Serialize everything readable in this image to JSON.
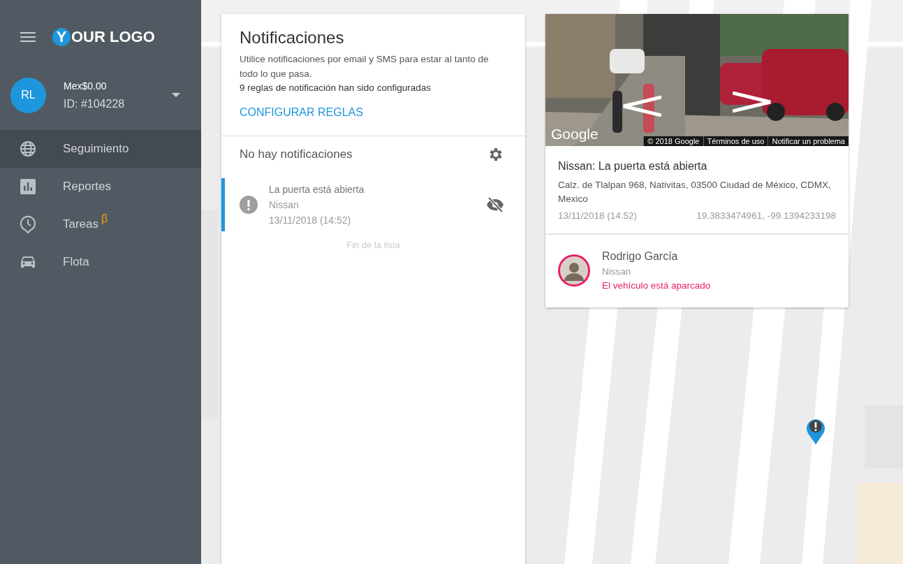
{
  "sidebar": {
    "logo": {
      "badge": "Y",
      "text": "OUR LOGO"
    },
    "account": {
      "initials": "RL",
      "balance": "Mex$0.00",
      "id": "ID: #104228"
    },
    "items": [
      {
        "label": "Seguimiento",
        "selected": true
      },
      {
        "label": "Reportes",
        "selected": false
      },
      {
        "label": "Tareas",
        "selected": false,
        "badge": "β"
      },
      {
        "label": "Flota",
        "selected": false
      }
    ]
  },
  "notifications": {
    "title": "Notificaciones",
    "description": "Utilice notificaciones por email y SMS para estar al tanto de todo lo que pasa.",
    "rules_count": "9 reglas de notificación han sido configuradas",
    "configure_button": "CONFIGURAR REGLAS",
    "empty_message": "No hay notificaciones",
    "items": [
      {
        "title": "La puerta está abierta",
        "vehicle": "Nissan",
        "time": "13/11/2018 (14:52)",
        "selected": true
      }
    ],
    "end_of_list": "Fin de la lista"
  },
  "detail": {
    "street_view": {
      "logo": "Google",
      "attribution": [
        "© 2018 Google",
        "Términos de uso",
        "Notificar un problema"
      ]
    },
    "title": "Nissan: La puerta está abierta",
    "address": "Calz. de Tlalpan 968, Nativitas, 03500 Ciudad de México, CDMX, Mexico",
    "time": "13/11/2018 (14:52)",
    "coordinates": "19.3833474961, -99.1394233198",
    "driver": {
      "name": "Rodrigo García",
      "vehicle": "Nissan",
      "status": "El vehículo está aparcado"
    }
  }
}
